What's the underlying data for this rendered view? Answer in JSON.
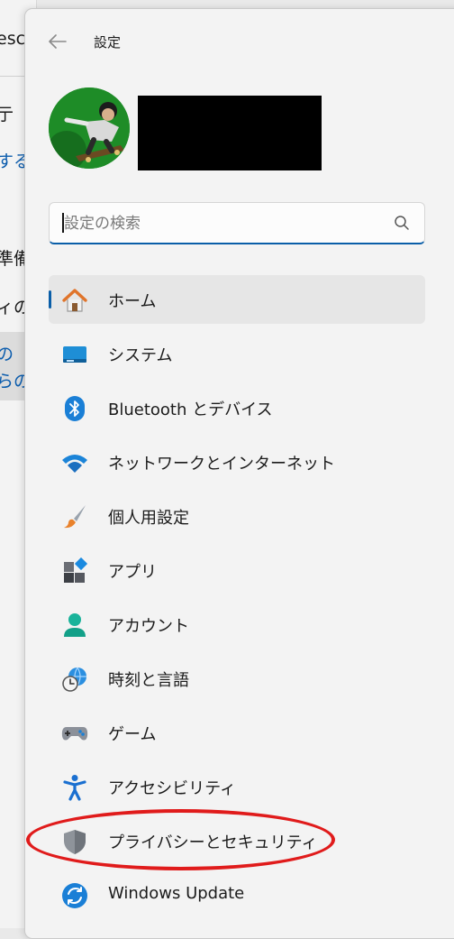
{
  "background_window": {
    "fragments": [
      {
        "text": "esc",
        "color": "dark"
      },
      {
        "text": "亍",
        "color": "dark"
      },
      {
        "text": "する",
        "color": "blue"
      },
      {
        "text": "準備",
        "color": "dark"
      },
      {
        "text": "ィの",
        "color": "dark"
      },
      {
        "text": "の",
        "color": "blue"
      },
      {
        "text": "らの",
        "color": "blue"
      }
    ]
  },
  "window": {
    "title": "設定",
    "back_icon": "arrow-left-icon"
  },
  "profile": {
    "avatar": "user-avatar-photo"
  },
  "search": {
    "placeholder": "設定の検索",
    "value": "",
    "icon": "search-icon"
  },
  "nav": {
    "items": [
      {
        "label": "ホーム",
        "icon": "home-icon",
        "selected": true
      },
      {
        "label": "システム",
        "icon": "system-display-icon"
      },
      {
        "label": "Bluetooth とデバイス",
        "icon": "bluetooth-icon"
      },
      {
        "label": "ネットワークとインターネット",
        "icon": "wifi-icon"
      },
      {
        "label": "個人用設定",
        "icon": "paintbrush-icon"
      },
      {
        "label": "アプリ",
        "icon": "apps-icon"
      },
      {
        "label": "アカウント",
        "icon": "account-icon"
      },
      {
        "label": "時刻と言語",
        "icon": "time-language-icon"
      },
      {
        "label": "ゲーム",
        "icon": "gamepad-icon"
      },
      {
        "label": "アクセシビリティ",
        "icon": "accessibility-icon"
      },
      {
        "label": "プライバシーとセキュリティ",
        "icon": "shield-icon"
      },
      {
        "label": "Windows Update",
        "icon": "windows-update-icon"
      }
    ]
  },
  "colors": {
    "accent": "#0a5ea8",
    "annotation": "#e01b1b"
  }
}
